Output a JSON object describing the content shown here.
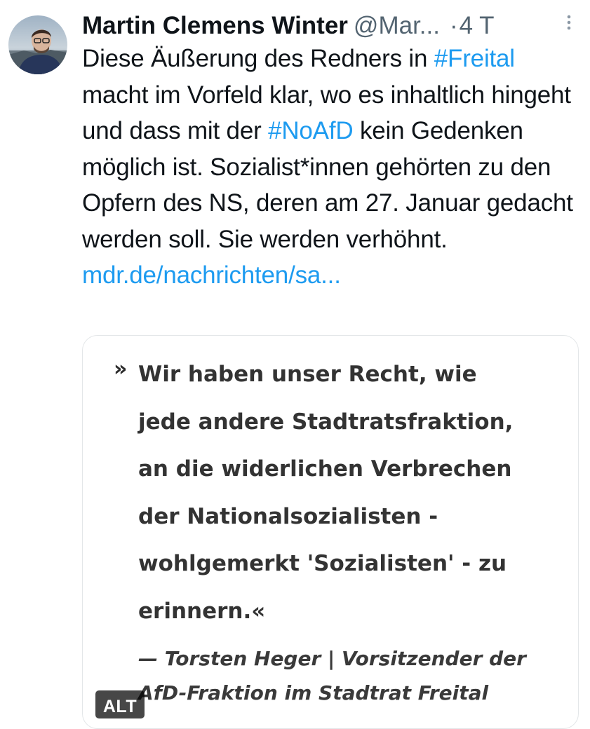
{
  "tweet": {
    "author": {
      "display_name": "Martin Clemens Winter",
      "handle": "@Mar...",
      "avatar_icon": "user-avatar-photo"
    },
    "separator": "·",
    "timestamp": "4 T",
    "more_icon": "more-vertical-icon",
    "text": {
      "part1": "Diese Äußerung des Redners in ",
      "hashtag1": "#Freital",
      "part2": " macht im Vorfeld klar, wo es inhaltlich hingeht und dass mit der ",
      "hashtag2": "#NoAfD",
      "part3": " kein Gedenken möglich ist. Sozialist*innen gehörten zu den Opfern des NS, deren am 27. Januar gedacht werden soll. Sie werden verhöhnt.",
      "link": "mdr.de/nachrichten/sa..."
    },
    "link_color": "#1d9bf0",
    "media": {
      "quote_mark": "»",
      "quote_lines": [
        "Wir haben unser Recht, wie",
        "jede andere Stadtratsfraktion,",
        "an die widerlichen Verbrechen",
        "der Nationalsozialisten -",
        "wohlgemerkt 'Sozialisten' - zu",
        "erinnern.«"
      ],
      "attribution_lines": [
        "— Torsten Heger | Vorsitzender der",
        "AfD-Fraktion im Stadtrat Freital"
      ],
      "alt_badge": "ALT"
    }
  }
}
